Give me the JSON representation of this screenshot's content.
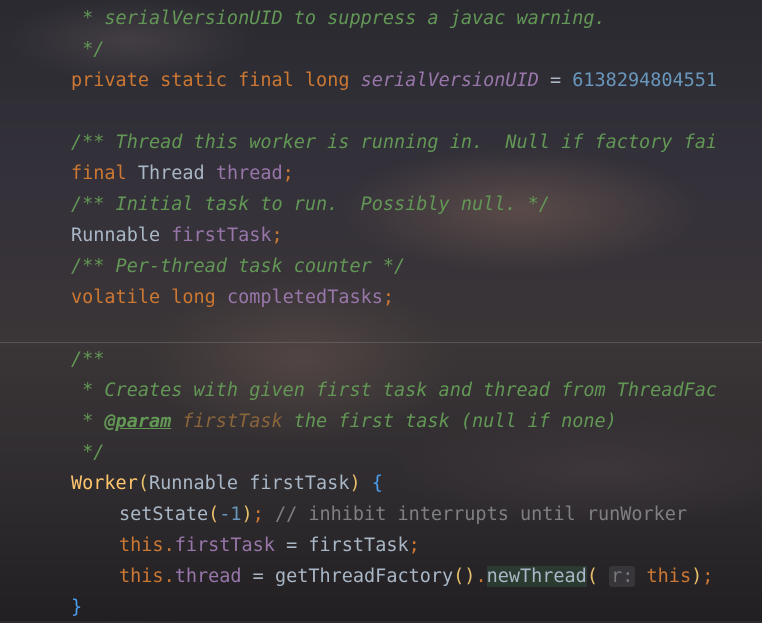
{
  "code": {
    "l1_text": " * serialVersionUID to suppress a javac warning.",
    "l2_text": " */",
    "l3_private": "private",
    "l3_static": "static",
    "l3_final": "final",
    "l3_long": "long",
    "l3_field": "serialVersionUID",
    "l3_eq": "=",
    "l3_num": "6138294804551",
    "l5_text": "/** Thread this worker is running in.  Null if factory fai",
    "l6_final": "final",
    "l6_type": "Thread",
    "l6_field": "thread",
    "l6_semi": ";",
    "l7_text": "/** Initial task to run.  Possibly null. */",
    "l8_type": "Runnable",
    "l8_field": "firstTask",
    "l8_semi": ";",
    "l9_text": "/** Per-thread task counter */",
    "l10_volatile": "volatile",
    "l10_long": "long",
    "l10_field": "completedTasks",
    "l10_semi": ";",
    "l12_text": "/**",
    "l13_text": " * Creates with given first task and thread from ThreadFac",
    "l14_star": " * ",
    "l14_tag": "@param",
    "l14_param": "firstTask",
    "l14_rest": " the first task (null if none)",
    "l15_text": " */",
    "l16_ctor": "Worker",
    "l16_open": "(",
    "l16_params": "Runnable firstTask",
    "l16_close": ")",
    "l16_brace": "{",
    "l17_call": "setState",
    "l17_open": "(",
    "l17_num": "-1",
    "l17_close": ")",
    "l17_semi": ";",
    "l17_comment": "// inhibit interrupts until runWorker",
    "l18_this": "this",
    "l18_dot": ".",
    "l18_field": "firstTask",
    "l18_rest": " = firstTask",
    "l18_semi": ";",
    "l19_this": "this",
    "l19_dot": ".",
    "l19_field": "thread",
    "l19_mid": " = getThreadFactory",
    "l19_parens": "()",
    "l19_dot2": ".",
    "l19_call": "newThread",
    "l19_open": "(",
    "l19_hint": "r:",
    "l19_arg": "this",
    "l19_close": ")",
    "l19_semi": ";",
    "l20_brace": "}"
  },
  "colors": {
    "keyword": "#cc7832",
    "doc_comment": "#629755",
    "field": "#9876aa",
    "number": "#6897bb",
    "identifier": "#a9b7c6",
    "method_decl": "#ffc66d",
    "line_comment": "#808080"
  }
}
